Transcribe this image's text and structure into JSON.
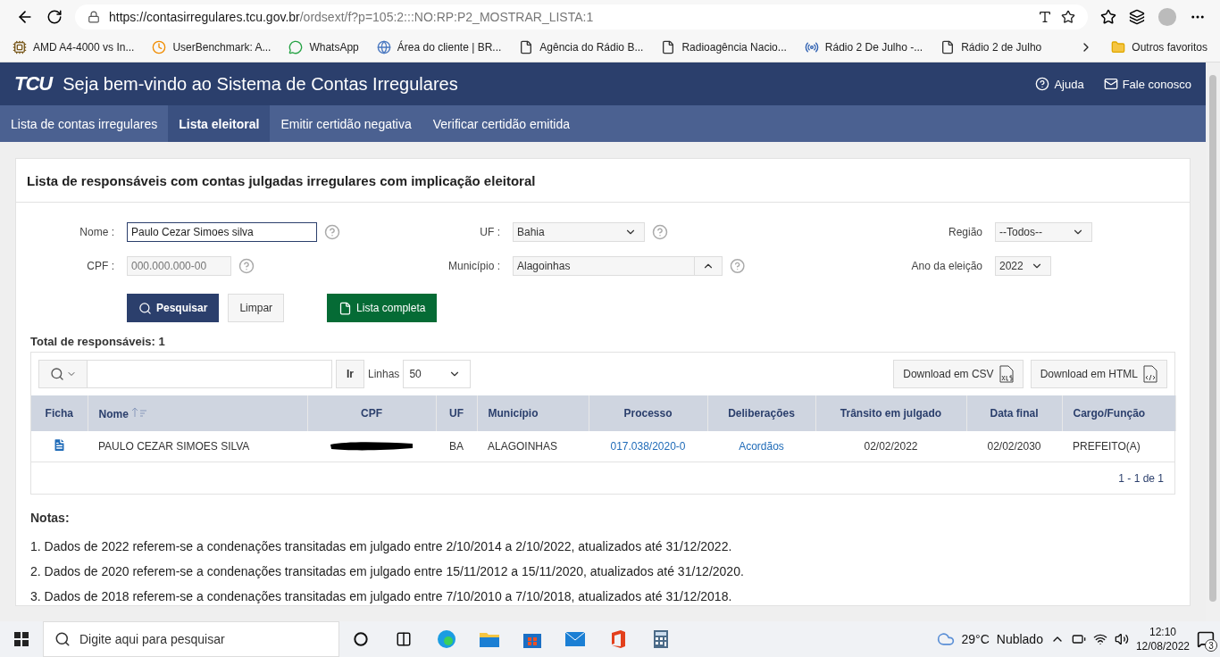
{
  "browser": {
    "url_host": "https://contasirregulares.tcu.gov.br",
    "url_path": "/ordsext/f?p=105:2:::NO:RP:P2_MOSTRAR_LISTA:1",
    "bookmarks": [
      {
        "label": "AMD A4-4000 vs In...",
        "kind": "chip"
      },
      {
        "label": "UserBenchmark: A...",
        "kind": "clock"
      },
      {
        "label": "WhatsApp",
        "kind": "whatsapp"
      },
      {
        "label": "Área do cliente | BR...",
        "kind": "globe"
      },
      {
        "label": "Agência do Rádio B...",
        "kind": "page"
      },
      {
        "label": "Radioagência Nacio...",
        "kind": "page"
      },
      {
        "label": "Rádio 2 De Julho -...",
        "kind": "radio"
      },
      {
        "label": "Rádio 2 de Julho",
        "kind": "page"
      }
    ],
    "other_bookmarks": "Outros favoritos"
  },
  "header": {
    "logo": "TCU",
    "title": "Seja bem-vindo ao Sistema de Contas Irregulares",
    "links": [
      "Ajuda",
      "Fale conosco"
    ]
  },
  "tabs": [
    {
      "label": "Lista de contas irregulares",
      "selected": false
    },
    {
      "label": "Lista eleitoral",
      "selected": true
    },
    {
      "label": "Emitir certidão negativa",
      "selected": false
    },
    {
      "label": "Verificar certidão emitida",
      "selected": false
    }
  ],
  "panel": {
    "title": "Lista de responsáveis com contas julgadas irregulares com implicação eleitoral",
    "nome": {
      "label": "Nome :",
      "value": "Paulo Cezar Simoes silva"
    },
    "cpf": {
      "label": "CPF :",
      "placeholder": "000.000.000-00"
    },
    "uf": {
      "label": "UF :",
      "value": "Bahia"
    },
    "municipio": {
      "label": "Município :",
      "value": "Alagoinhas"
    },
    "regiao": {
      "label": "Região",
      "value": "--Todos--"
    },
    "ano": {
      "label": "Ano da eleição",
      "value": "2022"
    },
    "buttons": {
      "search": "Pesquisar",
      "clear": "Limpar",
      "full_list": "Lista completa"
    },
    "total": "Total de responsáveis: 1",
    "toolbar": {
      "go": "Ir",
      "rows_label": "Linhas",
      "rows_value": "50",
      "downloads": [
        {
          "label": "Download em CSV",
          "kind": "xls"
        },
        {
          "label": "Download em HTML",
          "kind": "html"
        }
      ]
    },
    "table": {
      "columns": [
        {
          "label": "Ficha",
          "sorted": false
        },
        {
          "label": "Nome",
          "sorted": true
        },
        {
          "label": "CPF",
          "sorted": false
        },
        {
          "label": "UF",
          "sorted": false
        },
        {
          "label": "Município",
          "sorted": false
        },
        {
          "label": "Processo",
          "sorted": false
        },
        {
          "label": "Deliberações",
          "sorted": false
        },
        {
          "label": "Trânsito em julgado",
          "sorted": false
        },
        {
          "label": "Data final",
          "sorted": false
        },
        {
          "label": "Cargo/Função",
          "sorted": false
        }
      ],
      "rows": [
        {
          "nome": "PAULO CEZAR SIMOES SILVA",
          "cpf_redacted": true,
          "uf": "BA",
          "municipio": "ALAGOINHAS",
          "processo": "017.038/2020-0",
          "deliberacoes": "Acordãos",
          "transito": "02/02/2022",
          "data_final": "02/02/2030",
          "cargo": "PREFEITO(A)"
        }
      ],
      "pagination": "1 - 1 de 1"
    },
    "notes_title": "Notas:",
    "notes": [
      "1. Dados de 2022 referem-se a condenações transitadas em julgado entre 2/10/2014 a 2/10/2022, atualizados até 31/12/2022.",
      "2. Dados de 2020 referem-se a condenações transitadas em julgado entre 15/11/2012 a 15/11/2020, atualizados até 31/12/2020.",
      "3. Dados de 2018 referem-se a condenações transitadas em julgado entre 7/10/2010 a 7/10/2018, atualizados até 31/12/2018."
    ]
  },
  "taskbar": {
    "search_placeholder": "Digite aqui para pesquisar",
    "temperature": "29°C",
    "weather": "Nublado",
    "time": "12:10",
    "date": "12/08/2022",
    "notifications": "3"
  }
}
